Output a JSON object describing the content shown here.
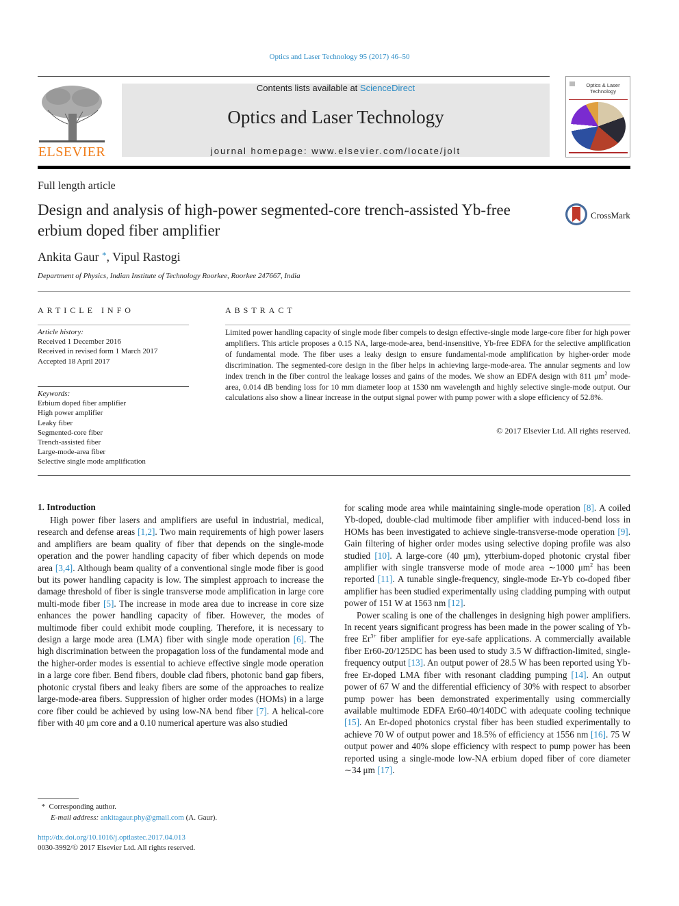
{
  "header": {
    "journal_ref": "Optics and Laser Technology 95 (2017) 46–50",
    "contents_prefix": "Contents lists available at ",
    "contents_link": "ScienceDirect",
    "journal_title": "Optics and Laser Technology",
    "homepage_prefix": "journal homepage: ",
    "homepage_url": "www.elsevier.com/locate/jolt",
    "publisher_logo_text": "ELSEVIER",
    "cover_title": "Optics & Laser Technology",
    "brand_color": "#f07d1a",
    "link_color": "#2a8bc5"
  },
  "article": {
    "type": "Full length article",
    "title": "Design and analysis of high-power segmented-core trench-assisted Yb-free erbium doped fiber amplifier",
    "crossmark_label": "CrossMark",
    "authors": [
      {
        "name": "Ankita Gaur",
        "mark": "*"
      },
      {
        "name": "Vipul Rastogi",
        "mark": ""
      }
    ],
    "author_separator": ", ",
    "affiliation": "Department of Physics, Indian Institute of Technology Roorkee, Roorkee 247667, India"
  },
  "article_info": {
    "heading": "ARTICLE INFO",
    "history_label": "Article history:",
    "history": [
      "Received 1 December 2016",
      "Received in revised form 1 March 2017",
      "Accepted 18 April 2017"
    ],
    "keywords_label": "Keywords:",
    "keywords": [
      "Erbium doped fiber amplifier",
      "High power amplifier",
      "Leaky fiber",
      "Segmented-core fiber",
      "Trench-assisted fiber",
      "Large-mode-area fiber",
      "Selective single mode amplification"
    ]
  },
  "abstract": {
    "heading": "ABSTRACT",
    "text_part1": "Limited power handling capacity of single mode fiber compels to design effective-single mode large-core fiber for high power amplifiers. This article proposes a 0.15 NA, large-mode-area, bend-insensitive, Yb-free EDFA for the selective amplification of fundamental mode. The fiber uses a leaky design to ensure fundamental-mode amplification by higher-order mode discrimination. The segmented-core design in the fiber helps in achieving large-mode-area. The annular segments and low index trench in the fiber control the leakage losses and gains of the modes. We show an EDFA design with 811 μm",
    "text_sup": "2",
    "text_part2": " mode-area, 0.014 dB bending loss for 10 mm diameter loop at 1530 nm wavelength and highly selective single-mode output. Our calculations also show a linear increase in the output signal power with pump power with a slope efficiency of 52.8%.",
    "copyright": "© 2017 Elsevier Ltd. All rights reserved."
  },
  "body": {
    "section_heading": "1. Introduction",
    "left_paragraph": [
      {
        "t": "High power fiber lasers and amplifiers are useful in industrial, medical, research and defense areas "
      },
      {
        "r": "[1,2]"
      },
      {
        "t": ". Two main requirements of high power lasers and amplifiers are beam quality of fiber that depends on the single-mode operation and the power handling capacity of fiber which depends on mode area "
      },
      {
        "r": "[3,4]"
      },
      {
        "t": ". Although beam quality of a conventional single mode fiber is good but its power handling capacity is low. The simplest approach to increase the damage threshold of fiber is single transverse mode amplification in large core multi-mode fiber "
      },
      {
        "r": "[5]"
      },
      {
        "t": ". The increase in mode area due to increase in core size enhances the power handling capacity of fiber. However, the modes of multimode fiber could exhibit mode coupling. Therefore, it is necessary to design a large mode area (LMA) fiber with single mode operation "
      },
      {
        "r": "[6]"
      },
      {
        "t": ". The high discrimination between the propagation loss of the fundamental mode and the higher-order modes is essential to achieve effective single mode operation in a large core fiber. Bend fibers, double clad fibers, photonic band gap fibers, photonic crystal fibers and leaky fibers are some of the approaches to realize large-mode-area fibers. Suppression of higher order modes (HOMs) in a large core fiber could be achieved by using low-NA bend fiber "
      },
      {
        "r": "[7]"
      },
      {
        "t": ". A helical-core fiber with 40 μm core and a 0.10 numerical aperture was also studied"
      }
    ],
    "right_paragraph_1": [
      {
        "t": "for scaling mode area while maintaining single-mode operation "
      },
      {
        "r": "[8]"
      },
      {
        "t": ". A coiled Yb-doped, double-clad multimode fiber amplifier with induced-bend loss in HOMs has been investigated to achieve single-transverse-mode operation "
      },
      {
        "r": "[9]"
      },
      {
        "t": ". Gain filtering of higher order modes using selective doping profile was also studied "
      },
      {
        "r": "[10]"
      },
      {
        "t": ". A large-core (40 μm), ytterbium-doped photonic crystal fiber amplifier with single transverse mode of mode area ∼1000 μm"
      },
      {
        "s": "2"
      },
      {
        "t": " has been reported "
      },
      {
        "r": "[11]"
      },
      {
        "t": ". A tunable single-frequency, single-mode Er-Yb co-doped fiber amplifier has been studied experimentally using cladding pumping with output power of 151 W at 1563 nm "
      },
      {
        "r": "[12]"
      },
      {
        "t": "."
      }
    ],
    "right_paragraph_2": [
      {
        "t": "Power scaling is one of the challenges in designing high power amplifiers. In recent years significant progress has been made in the power scaling of Yb-free Er"
      },
      {
        "s": "3+"
      },
      {
        "t": " fiber amplifier for eye-safe applications. A commercially available fiber Er60-20/125DC has been used to study 3.5 W diffraction-limited, single-frequency output "
      },
      {
        "r": "[13]"
      },
      {
        "t": ". An output power of 28.5 W has been reported using Yb-free Er-doped LMA fiber with resonant cladding pumping "
      },
      {
        "r": "[14]"
      },
      {
        "t": ". An output power of 67 W and the differential efficiency of 30% with respect to absorber pump power has been demonstrated experimentally using commercially available multimode EDFA Er60-40/140DC with adequate cooling technique "
      },
      {
        "r": "[15]"
      },
      {
        "t": ". An Er-doped photonics crystal fiber has been studied experimentally to achieve 70 W of output power and 18.5% of efficiency at 1556 nm "
      },
      {
        "r": "[16]"
      },
      {
        "t": ". 75 W output power and 40% slope efficiency with respect to pump power has been reported using a single-mode low-NA erbium doped fiber of core diameter ∼34 μm "
      },
      {
        "r": "[17]"
      },
      {
        "t": "."
      }
    ]
  },
  "footer": {
    "footnote_mark": "*",
    "corresponding": "Corresponding author.",
    "email_label": "E-mail address: ",
    "email": "ankitagaur.phy@gmail.com",
    "email_suffix": " (A. Gaur).",
    "doi": "http://dx.doi.org/10.1016/j.optlastec.2017.04.013",
    "issn_line": "0030-3992/© 2017 Elsevier Ltd. All rights reserved."
  }
}
